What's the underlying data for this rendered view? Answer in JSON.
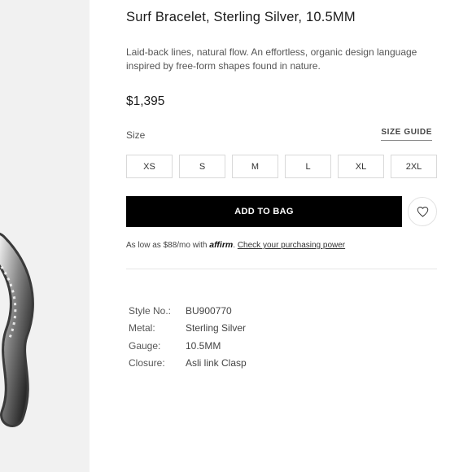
{
  "product": {
    "title": "Surf Bracelet, Sterling Silver, 10.5MM",
    "description": "Laid-back lines, natural flow. An effortless, organic design language inspired by free-form shapes found in nature.",
    "price": "$1,395"
  },
  "size_selector": {
    "label": "Size",
    "guide_label": "SIZE GUIDE",
    "options": [
      "XS",
      "S",
      "M",
      "L",
      "XL",
      "2XL"
    ]
  },
  "actions": {
    "add_to_bag_label": "ADD TO BAG",
    "wishlist_icon": "heart-icon"
  },
  "financing": {
    "prefix": "As low as $88/mo with",
    "provider": "affirm",
    "link_label": "Check your purchasing power"
  },
  "specs": [
    {
      "key": "Style No.:",
      "value": "BU900770"
    },
    {
      "key": "Metal:",
      "value": "Sterling Silver"
    },
    {
      "key": "Gauge:",
      "value": "10.5MM"
    },
    {
      "key": "Closure:",
      "value": "Asli link Clasp"
    }
  ],
  "colors": {
    "button_bg": "#000000",
    "image_panel_bg": "#f1f1f1"
  }
}
